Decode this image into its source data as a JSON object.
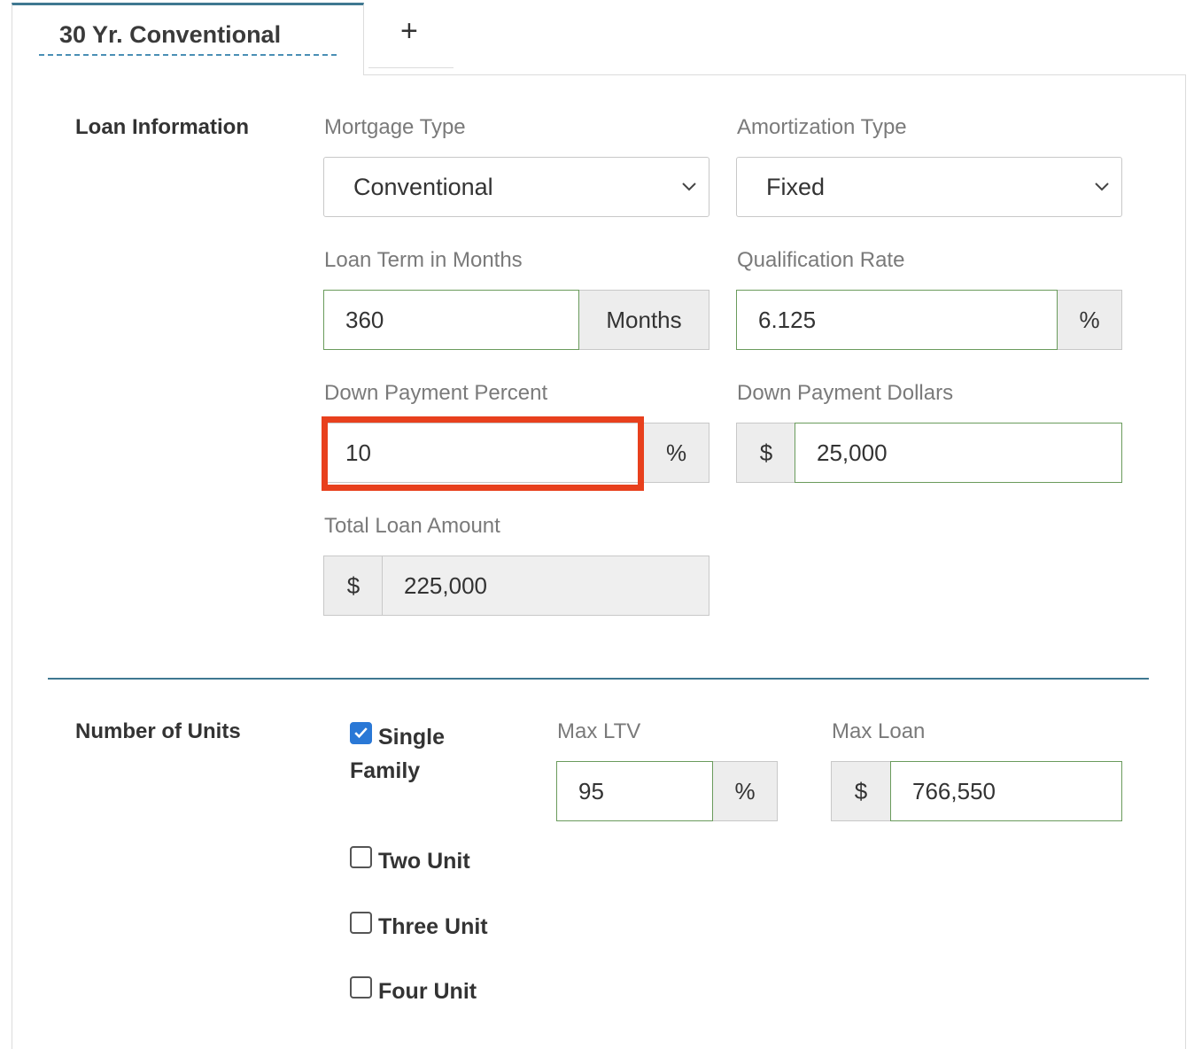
{
  "tabs": [
    {
      "label": "30 Yr. Conventional"
    },
    {
      "label": "+"
    }
  ],
  "loan_info": {
    "title": "Loan Information",
    "mortgage_type": {
      "label": "Mortgage Type",
      "value": "Conventional"
    },
    "amortization_type": {
      "label": "Amortization Type",
      "value": "Fixed"
    },
    "loan_term": {
      "label": "Loan Term in Months",
      "value": "360",
      "addon": "Months"
    },
    "qualification_rate": {
      "label": "Qualification Rate",
      "value": "6.125",
      "addon": "%"
    },
    "down_payment_percent": {
      "label": "Down Payment Percent",
      "value": "10",
      "addon": "%"
    },
    "down_payment_dollars": {
      "label": "Down Payment Dollars",
      "value": "25,000",
      "addon": "$"
    },
    "total_loan_amount": {
      "label": "Total Loan Amount",
      "value": "225,000",
      "addon": "$"
    }
  },
  "units": {
    "title": "Number of Units",
    "options": [
      {
        "label": "Single Family",
        "checked": true
      },
      {
        "label": "Two Unit",
        "checked": false
      },
      {
        "label": "Three Unit",
        "checked": false
      },
      {
        "label": "Four Unit",
        "checked": false
      }
    ],
    "max_ltv": {
      "label": "Max LTV",
      "value": "95",
      "addon": "%"
    },
    "max_loan": {
      "label": "Max Loan",
      "value": "766,550",
      "addon": "$"
    }
  },
  "colors": {
    "accent": "#3f7891",
    "valid_border": "#6a9b5c",
    "highlight": "#e8401d",
    "checkbox": "#2a78d6"
  }
}
